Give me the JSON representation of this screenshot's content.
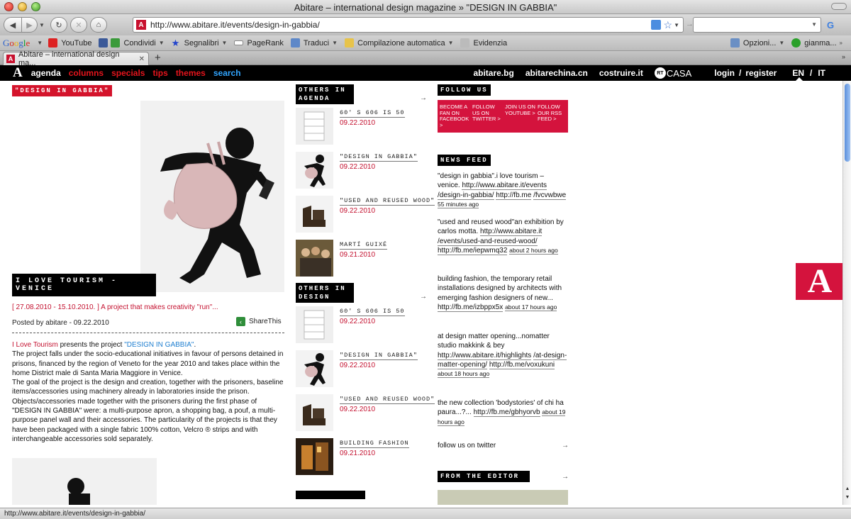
{
  "window": {
    "title": "Abitare – international design magazine » \"DESIGN IN GABBIA\""
  },
  "toolbar": {
    "url": "http://www.abitare.it/events/design-in-gabbia/",
    "search_placeholder": ""
  },
  "bookmarks": {
    "items": [
      {
        "label": "YouTube",
        "icon": "youtube-icon"
      },
      {
        "label": "Condividi",
        "icon": "share-icon"
      },
      {
        "label": "Segnalibri",
        "icon": "star-icon"
      },
      {
        "label": "PageRank",
        "icon": "pagerank-icon"
      },
      {
        "label": "Traduci",
        "icon": "translate-icon"
      },
      {
        "label": "Compilazione automatica",
        "icon": "autofill-icon"
      },
      {
        "label": "Evidenzia",
        "icon": "highlight-icon"
      }
    ],
    "right": [
      "Opzioni...",
      "gianma..."
    ]
  },
  "tabs": [
    {
      "label": "Abitare – international design ma..."
    }
  ],
  "site_nav": {
    "logo": "A",
    "items": [
      {
        "label": "agenda",
        "color": "#ffffff"
      },
      {
        "label": "columns",
        "color": "#e5141c"
      },
      {
        "label": "specials",
        "color": "#e5141c"
      },
      {
        "label": "tips",
        "color": "#e5141c"
      },
      {
        "label": "themes",
        "color": "#e5141c"
      },
      {
        "label": "search",
        "color": "#31a5ff"
      }
    ],
    "right": [
      "abitare.bg",
      "abitarechina.cn",
      "costruire.it"
    ],
    "casa": {
      "badge": "RT",
      "text": "CASA"
    },
    "login": "login",
    "sep": "/",
    "register": "register",
    "lang_en": "EN",
    "lang_it": "IT"
  },
  "article": {
    "section_label": "\"DESIGN IN GABBIA\"",
    "title": "I LOVE TOURISM - VENICE",
    "dates": "[ 27.08.2010 - 15.10.2010. ] A project that makes creativity \"run\"...",
    "posted": "Posted by abitare - 09.22.2010",
    "share_label": "ShareThis",
    "intro_link1": "I Love Tourism",
    "intro_mid": " presents the project ",
    "intro_link2": "\"DESIGN IN GABBIA\"",
    "intro_end": ".",
    "paragraphs": [
      "The project falls under the socio-educational initiatives in favour of persons detained in prisons, financed by the region of Veneto for the year 2010 and takes place within the home District male di Santa Maria Maggiore in Venice.",
      "The goal of the project is the design and creation, together with the prisoners, baseline items/accessories using machinery already in laboratories inside the prison.",
      "Objects/accessories made together with the prisoners during the first phase of \"DESIGN IN GABBIA\" were: a multi-purpose apron, a shopping bag, a pouf, a multi-purpose panel wall and their accessories. The particularity of the projects is that they have been packaged with a single fabric 100% cotton, Velcro ® strips and with interchangeable accessories sold separately."
    ]
  },
  "middle": {
    "agenda_label": "OTHERS IN AGENDA",
    "design_label": "OTHERS IN DESIGN",
    "arrow": "→",
    "agenda_items": [
      {
        "title": "60' S 606 IS 50",
        "date": "09.22.2010",
        "thumb": "shelf"
      },
      {
        "title": "\"DESIGN IN GABBIA\"",
        "date": "09.22.2010",
        "thumb": "figure"
      },
      {
        "title": "\"USED AND REUSED WOOD\"",
        "date": "09.22.2010",
        "thumb": "chair"
      },
      {
        "title": "MARTÍ GUIXÉ",
        "date": "09.21.2010",
        "thumb": "people"
      }
    ],
    "design_items": [
      {
        "title": "60' S 606 IS 50",
        "date": "09.22.2010",
        "thumb": "shelf"
      },
      {
        "title": "\"DESIGN IN GABBIA\"",
        "date": "09.22.2010",
        "thumb": "figure"
      },
      {
        "title": "\"USED AND REUSED WOOD\"",
        "date": "09.22.2010",
        "thumb": "chair"
      },
      {
        "title": "BUILDING FASHION",
        "date": "09.21.2010",
        "thumb": "building"
      }
    ]
  },
  "right": {
    "follow_label": "FOLLOW US",
    "follow": [
      "BECOME A FAN ON FACEBOOK >",
      "FOLLOW US ON TWITTER >",
      "JOIN US ON YOUTUBE >",
      "FOLLOW OUR RSS FEED >"
    ],
    "news_label": "NEWS FEED",
    "feed": [
      {
        "text": "\"design in gabbia\".i love tourism – venice. ",
        "links": [
          "http://www.abitare.it/events",
          "/design-in-gabbia/",
          "http://fb.me",
          "/fvcvwbwe"
        ],
        "ago": "55 minutes ago"
      },
      {
        "text": "\"used and reused wood\"an exhibition by carlos motta. ",
        "links": [
          "http://www.abitare.it",
          "/events/used-and-reused-wood/",
          "http://fb.me/iepwmq32"
        ],
        "ago": "about 2 hours ago"
      },
      {
        "text": "building fashion, the temporary retail installations designed by architects with emerging fashion designers of new... ",
        "links": [
          "http://fb.me/izbppx5x"
        ],
        "ago": "about 17 hours ago"
      },
      {
        "text": "at design matter opening...nomatter studio makkink & bey ",
        "links": [
          "http://www.abitare.it/highlights",
          "/at-design-matter-opening/",
          "http://fb.me/voxukuni"
        ],
        "ago": "about 18 hours ago"
      },
      {
        "text": "the new collection 'bodystories' of chi ha paura...?... ",
        "links": [
          "http://fb.me/gbhyorvb"
        ],
        "ago": "about 19 hours ago"
      }
    ],
    "twitter": "follow us on twitter",
    "editor_label": "FROM THE EDITOR"
  },
  "status": {
    "text": "http://www.abitare.it/events/design-in-gabbia/"
  },
  "colors": {
    "brand_red": "#d4133d",
    "link_red": "#c41230",
    "nav_blue": "#31a5ff"
  }
}
